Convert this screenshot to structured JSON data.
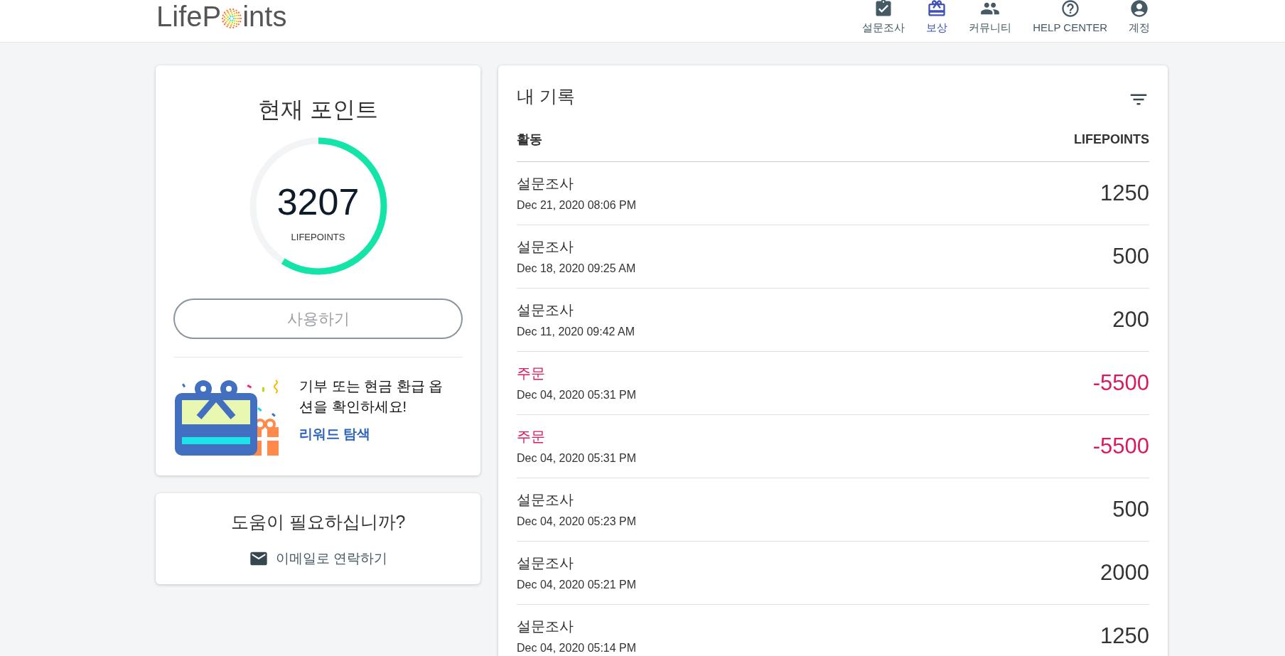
{
  "logo": {
    "before": "LifeP",
    "after": "ints"
  },
  "nav": [
    {
      "label": "설문조사",
      "kind": "survey",
      "selected": false
    },
    {
      "label": "보상",
      "kind": "reward",
      "selected": true
    },
    {
      "label": "커뮤니티",
      "kind": "community",
      "selected": false
    },
    {
      "label": "HELP CENTER",
      "kind": "help",
      "selected": false
    },
    {
      "label": "계정",
      "kind": "account",
      "selected": false
    }
  ],
  "points_card": {
    "title": "현재 포인트",
    "points": "3207",
    "unit": "LIFEPOINTS",
    "level": 0.59,
    "redeem_button": {
      "label": "사용하기",
      "disabled": true
    },
    "promo": {
      "text": "기부 또는 현금 환급 옵션을 확인하세요!",
      "link": "리워드 탐색"
    }
  },
  "help_card": {
    "title": "도움이 필요하십니까?",
    "contact_link": "이메일로 연락하기"
  },
  "history": {
    "title": "내 기록",
    "columns": [
      "활동",
      "LIFEPOINTS"
    ],
    "rows": [
      {
        "kind": "survey",
        "activity": "설문조사",
        "date": "Dec 21, 2020 08:06 PM",
        "points": "1250"
      },
      {
        "kind": "survey",
        "activity": "설문조사",
        "date": "Dec 18, 2020 09:25 AM",
        "points": "500"
      },
      {
        "kind": "survey",
        "activity": "설문조사",
        "date": "Dec 11, 2020 09:42 AM",
        "points": "200"
      },
      {
        "kind": "order",
        "activity": "주문",
        "date": "Dec 04, 2020 05:31 PM",
        "points": "-5500"
      },
      {
        "kind": "order",
        "activity": "주문",
        "date": "Dec 04, 2020 05:31 PM",
        "points": "-5500"
      },
      {
        "kind": "survey",
        "activity": "설문조사",
        "date": "Dec 04, 2020 05:23 PM",
        "points": "500"
      },
      {
        "kind": "survey",
        "activity": "설문조사",
        "date": "Dec 04, 2020 05:21 PM",
        "points": "2000"
      },
      {
        "kind": "survey",
        "activity": "설문조사",
        "date": "Dec 04, 2020 05:14 PM",
        "points": "1250"
      }
    ]
  }
}
